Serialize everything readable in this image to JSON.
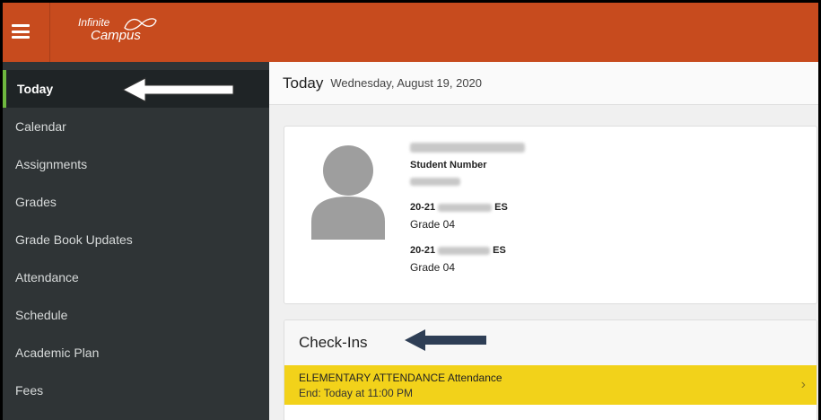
{
  "header": {
    "logo_line1": "Infinite",
    "logo_line2": "Campus",
    "brand_color": "#c74b1e"
  },
  "sidebar": {
    "items": [
      {
        "label": "Today",
        "active": true
      },
      {
        "label": "Calendar"
      },
      {
        "label": "Assignments"
      },
      {
        "label": "Grades"
      },
      {
        "label": "Grade Book Updates"
      },
      {
        "label": "Attendance"
      },
      {
        "label": "Schedule"
      },
      {
        "label": "Academic Plan"
      },
      {
        "label": "Fees"
      }
    ]
  },
  "main": {
    "title": "Today",
    "date": "Wednesday, August 19, 2020",
    "student": {
      "number_label": "Student Number",
      "enrollments": [
        {
          "prefix": "20-21",
          "suffix": "ES",
          "grade": "Grade 04"
        },
        {
          "prefix": "20-21",
          "suffix": "ES",
          "grade": "Grade 04"
        }
      ]
    },
    "checkins": {
      "title": "Check-Ins",
      "items": [
        {
          "name": "ELEMENTARY ATTENDANCE Attendance",
          "detail": "End: Today at 11:00 PM",
          "color": "#f2d21a"
        }
      ]
    }
  }
}
